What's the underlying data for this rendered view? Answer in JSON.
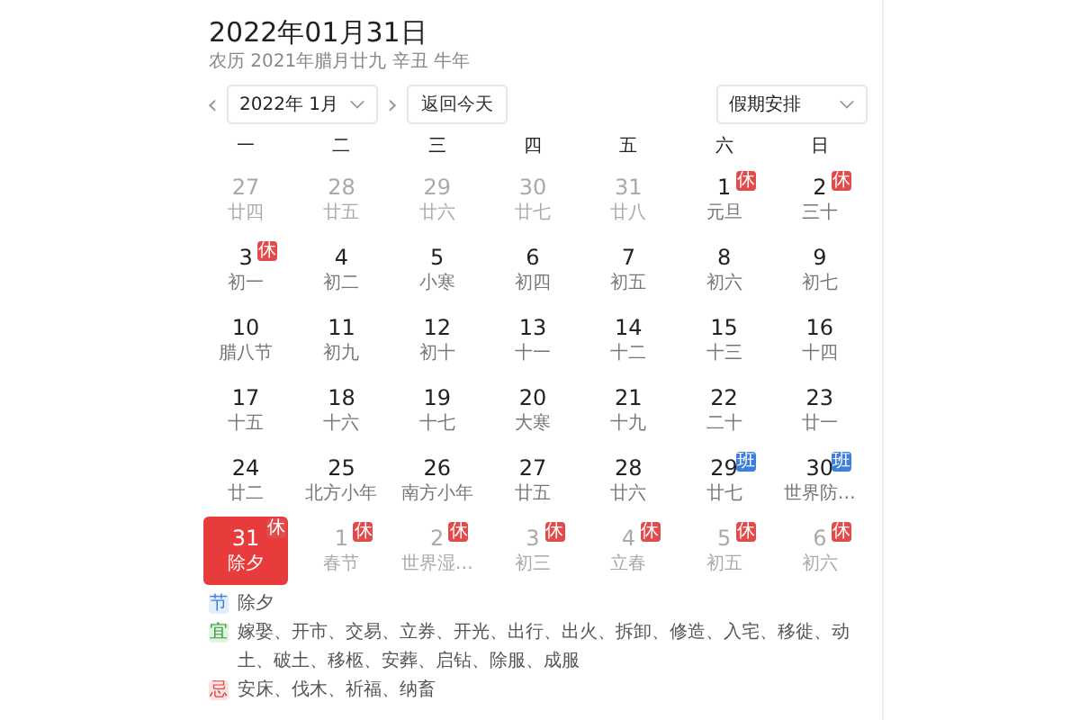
{
  "title": "2022年01月31日",
  "lunar_date": "农历 2021年腊月廿九 辛丑 牛年",
  "prev_icon": "‹",
  "month_select": "2022年 1月",
  "next_icon": "›",
  "today_button": "返回今天",
  "holiday_select": "假期安排",
  "weekdays": [
    "一",
    "二",
    "三",
    "四",
    "五",
    "六",
    "日"
  ],
  "days": [
    {
      "day": "27",
      "lunar": "廿四",
      "other_month": true,
      "selected": false
    },
    {
      "day": "28",
      "lunar": "廿五",
      "other_month": true,
      "selected": false
    },
    {
      "day": "29",
      "lunar": "廿六",
      "other_month": true,
      "selected": false
    },
    {
      "day": "30",
      "lunar": "廿七",
      "other_month": true,
      "selected": false
    },
    {
      "day": "31",
      "lunar": "廿八",
      "other_month": true,
      "selected": false
    },
    {
      "day": "1",
      "lunar": "元旦",
      "other_month": false,
      "badge": "休",
      "color": "#e04b4b",
      "selected": false
    },
    {
      "day": "2",
      "lunar": "三十",
      "other_month": false,
      "badge": "休",
      "color": "#e04b4b",
      "selected": false
    },
    {
      "day": "3",
      "lunar": "初一",
      "other_month": false,
      "badge": "休",
      "color": "#e04b4b",
      "selected": false
    },
    {
      "day": "4",
      "lunar": "初二",
      "other_month": false,
      "selected": false
    },
    {
      "day": "5",
      "lunar": "小寒",
      "other_month": false,
      "selected": false
    },
    {
      "day": "6",
      "lunar": "初四",
      "other_month": false,
      "selected": false
    },
    {
      "day": "7",
      "lunar": "初五",
      "other_month": false,
      "selected": false
    },
    {
      "day": "8",
      "lunar": "初六",
      "other_month": false,
      "selected": false
    },
    {
      "day": "9",
      "lunar": "初七",
      "other_month": false,
      "selected": false
    },
    {
      "day": "10",
      "lunar": "腊八节",
      "other_month": false,
      "selected": false
    },
    {
      "day": "11",
      "lunar": "初九",
      "other_month": false,
      "selected": false
    },
    {
      "day": "12",
      "lunar": "初十",
      "other_month": false,
      "selected": false
    },
    {
      "day": "13",
      "lunar": "十一",
      "other_month": false,
      "selected": false
    },
    {
      "day": "14",
      "lunar": "十二",
      "other_month": false,
      "selected": false
    },
    {
      "day": "15",
      "lunar": "十三",
      "other_month": false,
      "selected": false
    },
    {
      "day": "16",
      "lunar": "十四",
      "other_month": false,
      "selected": false
    },
    {
      "day": "17",
      "lunar": "十五",
      "other_month": false,
      "selected": false
    },
    {
      "day": "18",
      "lunar": "十六",
      "other_month": false,
      "selected": false
    },
    {
      "day": "19",
      "lunar": "十七",
      "other_month": false,
      "selected": false
    },
    {
      "day": "20",
      "lunar": "大寒",
      "other_month": false,
      "selected": false
    },
    {
      "day": "21",
      "lunar": "十九",
      "other_month": false,
      "selected": false
    },
    {
      "day": "22",
      "lunar": "二十",
      "other_month": false,
      "selected": false
    },
    {
      "day": "23",
      "lunar": "廿一",
      "other_month": false,
      "selected": false
    },
    {
      "day": "24",
      "lunar": "廿二",
      "other_month": false,
      "selected": false
    },
    {
      "day": "25",
      "lunar": "北方小年",
      "other_month": false,
      "selected": false
    },
    {
      "day": "26",
      "lunar": "南方小年",
      "other_month": false,
      "selected": false
    },
    {
      "day": "27",
      "lunar": "廿五",
      "other_month": false,
      "selected": false
    },
    {
      "day": "28",
      "lunar": "廿六",
      "other_month": false,
      "selected": false
    },
    {
      "day": "29",
      "lunar": "廿七",
      "other_month": false,
      "badge": "班",
      "color": "#3f7fd8",
      "selected": false
    },
    {
      "day": "30",
      "lunar": "世界防…",
      "other_month": false,
      "badge": "班",
      "color": "#3f7fd8",
      "selected": false
    },
    {
      "day": "31",
      "lunar": "除夕",
      "other_month": false,
      "badge": "休",
      "color": "#e04b4b",
      "selected": true
    },
    {
      "day": "1",
      "lunar": "春节",
      "other_month": true,
      "badge": "休",
      "color": "#e04b4b",
      "selected": false
    },
    {
      "day": "2",
      "lunar": "世界湿…",
      "other_month": true,
      "badge": "休",
      "color": "#e04b4b",
      "selected": false
    },
    {
      "day": "3",
      "lunar": "初三",
      "other_month": true,
      "badge": "休",
      "color": "#e04b4b",
      "selected": false
    },
    {
      "day": "4",
      "lunar": "立春",
      "other_month": true,
      "badge": "休",
      "color": "#e04b4b",
      "selected": false
    },
    {
      "day": "5",
      "lunar": "初五",
      "other_month": true,
      "badge": "休",
      "color": "#e04b4b",
      "selected": false
    },
    {
      "day": "6",
      "lunar": "初六",
      "other_month": true,
      "badge": "休",
      "color": "#e04b4b",
      "selected": false
    }
  ],
  "details": [
    {
      "kind": "festival",
      "tag": "节",
      "text": "除夕"
    },
    {
      "kind": "good",
      "tag": "宜",
      "text": "嫁娶、开市、交易、立券、开光、出行、出火、拆卸、修造、入宅、移徙、动土、破土、移柩、安葬、启钻、除服、成服"
    },
    {
      "kind": "bad",
      "tag": "忌",
      "text": "安床、伐木、祈福、纳畜"
    }
  ]
}
